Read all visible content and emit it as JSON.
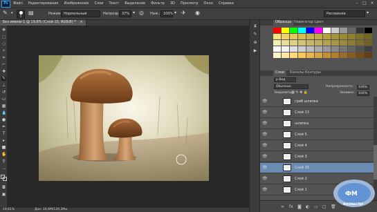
{
  "app": {
    "logo": "Ps",
    "workspace_preset": "Рисование"
  },
  "menu": [
    "Файл",
    "Редактирование",
    "Изображение",
    "Слои",
    "Текст",
    "Выделение",
    "Фильтр",
    "3D",
    "Просмотр",
    "Окно",
    "Справка"
  ],
  "options": {
    "brush_size": "5",
    "mode_label": "Режим:",
    "mode_value": "Нормальный",
    "opacity_label": "Непрозр.:",
    "opacity_value": "37%",
    "flow_label": "Наж.:",
    "flow_value": "100%"
  },
  "document": {
    "tab_title": "Без имени-1 @ 19,6% (Слой 15, RGB/8) *"
  },
  "status": {
    "zoom": "19,61%",
    "doc_info": "Док: 16,6М/129,3М"
  },
  "panels": {
    "swatches_tabs": [
      "Образцы",
      "Навигатор",
      "Цвет"
    ],
    "layers_tabs": [
      "Слои",
      "Каналы",
      "Контуры"
    ],
    "filter_label": "р Вид",
    "blend_mode": "Обычные",
    "opacity_label": "Непрозрачность:",
    "opacity_value": "100%",
    "lock_label": "Закрепить:",
    "fill_label": "Заливка:",
    "fill_value": "100%"
  },
  "layers": [
    {
      "name": "гриб шляпка",
      "selected": false
    },
    {
      "name": "Слой 13",
      "selected": false
    },
    {
      "name": "шляпка",
      "selected": false
    },
    {
      "name": "Слой 5",
      "selected": false
    },
    {
      "name": "Слой 4",
      "selected": false
    },
    {
      "name": "Слой 3",
      "selected": false
    },
    {
      "name": "Слой 15",
      "selected": true
    },
    {
      "name": "Слой 2",
      "selected": false
    },
    {
      "name": "Слой 1",
      "selected": false
    }
  ],
  "colors": {
    "accent_selected_row": "#6b8bb3",
    "ps_blue": "#31a8ff",
    "foreground": "#3a2210",
    "background": "#f2ead8"
  },
  "watermark": "ФЛОМАСТЕР"
}
